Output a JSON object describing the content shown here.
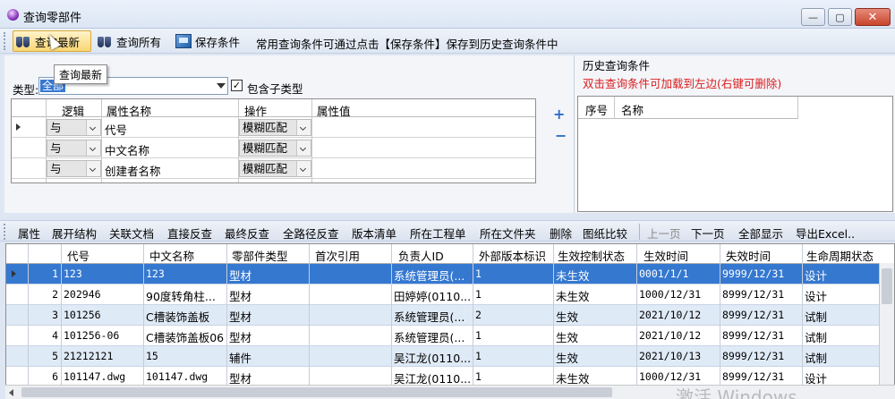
{
  "window": {
    "title": "查询零部件",
    "controls": [
      "—",
      "▢",
      "✕"
    ]
  },
  "toolbar": {
    "query_latest": "查询最新",
    "query_all": "查询所有",
    "save_condition": "保存条件",
    "hint": "常用查询条件可通过点击【保存条件】保存到历史查询条件中"
  },
  "tooltip": "查询最新",
  "query": {
    "type_label": "类型:",
    "type_value": "全部",
    "include_subtype": "包含子类型",
    "columns": [
      "逻辑",
      "属性名称",
      "操作",
      "属性值"
    ],
    "rows": [
      {
        "logic": "与",
        "attr": "代号",
        "op": "模糊匹配",
        "value": ""
      },
      {
        "logic": "与",
        "attr": "中文名称",
        "op": "模糊匹配",
        "value": ""
      },
      {
        "logic": "与",
        "attr": "创建者名称",
        "op": "模糊匹配",
        "value": ""
      }
    ],
    "add": "+",
    "remove": "−"
  },
  "history": {
    "title": "历史查询条件",
    "hint": "双击查询条件可加载到左边(右键可删除)",
    "columns": [
      "序号",
      "名称"
    ]
  },
  "actions": [
    "属性",
    "展开结构",
    "关联文档",
    "直接反查",
    "最终反查",
    "全路径反查",
    "版本清单",
    "所在工程单",
    "所在文件夹",
    "删除",
    "图纸比较",
    "上一页",
    "下一页",
    "全部显示",
    "导出Excel.."
  ],
  "grid": {
    "columns": [
      "代号",
      "中文名称",
      "零部件类型",
      "首次引用",
      "负责人ID",
      "外部版本标识",
      "生效控制状态",
      "生效时间",
      "失效时间",
      "生命周期状态"
    ],
    "rows": [
      {
        "n": "1",
        "code": "123",
        "name": "123",
        "type": "型材",
        "first": "",
        "owner": "系统管理员(...",
        "ver": "1",
        "status": "未生效",
        "eff": "0001/1/1",
        "exp": "9999/12/31",
        "life": "设计"
      },
      {
        "n": "2",
        "code": "202946",
        "name": "90度转角柱...",
        "type": "型材",
        "first": "",
        "owner": "田婷婷(0110...",
        "ver": "1",
        "status": "未生效",
        "eff": "1000/12/31",
        "exp": "8999/12/31",
        "life": "设计"
      },
      {
        "n": "3",
        "code": "101256",
        "name": "C槽装饰盖板",
        "type": "型材",
        "first": "",
        "owner": "系统管理员(...",
        "ver": "2",
        "status": "生效",
        "eff": "2021/10/12",
        "exp": "8999/12/31",
        "life": "试制"
      },
      {
        "n": "4",
        "code": "101256-06",
        "name": "C槽装饰盖板06",
        "type": "型材",
        "first": "",
        "owner": "系统管理员(...",
        "ver": "1",
        "status": "生效",
        "eff": "2021/10/12",
        "exp": "8999/12/31",
        "life": "试制"
      },
      {
        "n": "5",
        "code": "21212121",
        "name": "15",
        "type": "辅件",
        "first": "",
        "owner": "吴江龙(0110...",
        "ver": "1",
        "status": "生效",
        "eff": "2021/10/13",
        "exp": "8999/12/31",
        "life": "试制"
      },
      {
        "n": "6",
        "code": "101147.dwg",
        "name": "101147.dwg",
        "type": "型材",
        "first": "",
        "owner": "吴江龙(0110...",
        "ver": "1",
        "status": "未生效",
        "eff": "1000/12/31",
        "exp": "8999/12/31",
        "life": "设计"
      }
    ]
  },
  "watermark": "激活 Windows"
}
